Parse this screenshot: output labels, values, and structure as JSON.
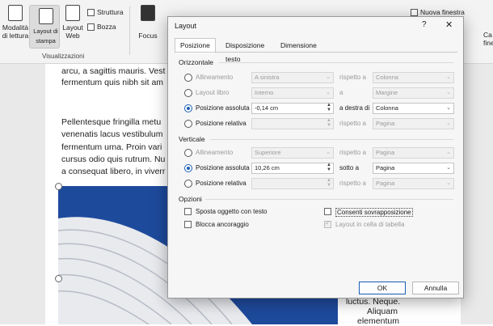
{
  "ribbon": {
    "buttons": [
      {
        "label_1": "Modalità",
        "label_2": "di lettura"
      },
      {
        "label_1": "Layout di",
        "label_2": "stampa"
      },
      {
        "label_1": "Layout",
        "label_2": "Web"
      }
    ],
    "struttura": "Struttura",
    "bozza": "Bozza",
    "focus": "Focus",
    "group_label": "Visualizzazioni",
    "nuova_finestra": "Nuova finestra",
    "right_cut_1": "Ca",
    "right_cut_2": "fine"
  },
  "document": {
    "lines": [
      "arcu, a sagittis mauris. Vest",
      "fermentum quis nibh sit am",
      "Pellentesque fringilla metu",
      "venenatis lacus vestibulum",
      "fermentum urna. Proin vari",
      "cursus odio quis rutrum. Nu",
      "a consequat libero, in viverr"
    ],
    "right_lines": [
      "luctus. Neque.",
      "Aliquam",
      "elementum"
    ]
  },
  "dialog": {
    "title": "Layout",
    "help": "?",
    "close": "✕",
    "tabs": [
      "Posizione",
      "Disposizione testo",
      "Dimensione"
    ],
    "horizontal": {
      "section": "Orizzontale",
      "rows": [
        {
          "label": "Allineamento",
          "value": "A sinistra",
          "rel_label": "rispetto a",
          "rel_value": "Colonna"
        },
        {
          "label": "Layout libro",
          "value": "Interno",
          "rel_label": "a",
          "rel_value": "Margine"
        },
        {
          "label": "Posizione assoluta",
          "value": "-0,14 cm",
          "rel_label": "a destra di",
          "rel_value": "Colonna"
        },
        {
          "label": "Posizione relativa",
          "value": "",
          "rel_label": "rispetto a",
          "rel_value": "Pagina"
        }
      ]
    },
    "vertical": {
      "section": "Verticale",
      "rows": [
        {
          "label": "Allineamento",
          "value": "Superiore",
          "rel_label": "rispetto a",
          "rel_value": "Pagina"
        },
        {
          "label": "Posizione assoluta",
          "value": "10,26 cm",
          "rel_label": "sotto a",
          "rel_value": "Pagina"
        },
        {
          "label": "Posizione relativa",
          "value": "",
          "rel_label": "rispetto a",
          "rel_value": "Pagina"
        }
      ]
    },
    "options": {
      "section": "Opzioni",
      "sposta": "Sposta oggetto con testo",
      "blocca": "Blocca ancoraggio",
      "consenti": "Consenti sovrapposizione",
      "layout_cella": "Layout in cella di tabella"
    },
    "ok": "OK",
    "annulla": "Annulla"
  }
}
